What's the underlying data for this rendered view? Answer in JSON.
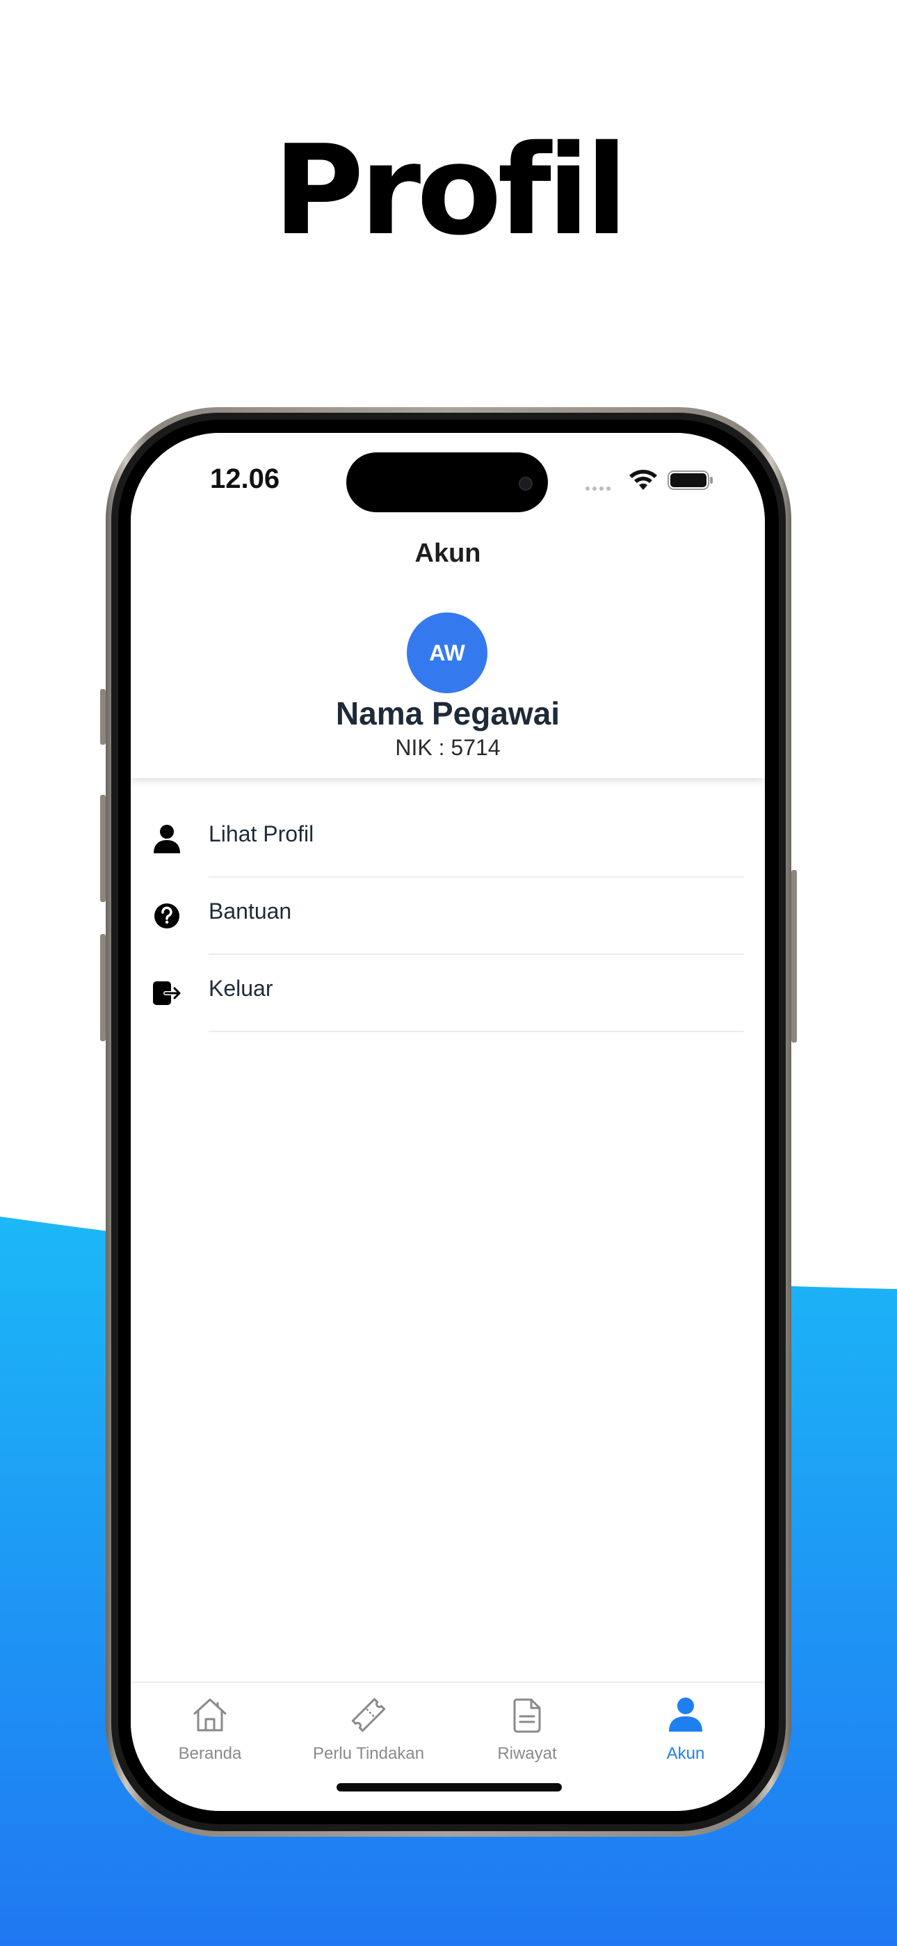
{
  "promo": {
    "title": "Profil"
  },
  "status_bar": {
    "time": "12.06"
  },
  "header": {
    "title": "Akun",
    "avatar_initials": "AW",
    "name": "Nama Pegawai",
    "nik": "NIK : 5714"
  },
  "menu": [
    {
      "label": "Lihat Profil",
      "icon": "person-icon"
    },
    {
      "label": "Bantuan",
      "icon": "question-circle-icon"
    },
    {
      "label": "Keluar",
      "icon": "logout-icon"
    }
  ],
  "tabs": [
    {
      "label": "Beranda",
      "icon": "home-icon",
      "active": false
    },
    {
      "label": "Perlu Tindakan",
      "icon": "ticket-icon",
      "active": false
    },
    {
      "label": "Riwayat",
      "icon": "document-icon",
      "active": false
    },
    {
      "label": "Akun",
      "icon": "person-icon",
      "active": true
    }
  ],
  "colors": {
    "accent": "#1E7FF0",
    "avatar": "#3579EF",
    "background_gradient_top": "#1CB8F7",
    "background_gradient_bottom": "#1F78F2"
  }
}
